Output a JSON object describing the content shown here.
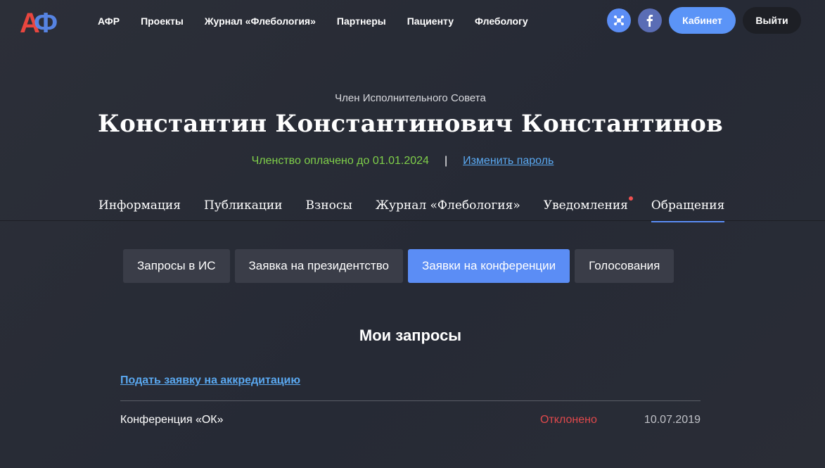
{
  "header": {
    "logo": {
      "text": "АФ",
      "colors": [
        "#e8463f",
        "#5b8df5"
      ]
    },
    "nav": [
      "АФР",
      "Проекты",
      "Журнал «Флебология»",
      "Партнеры",
      "Пациенту",
      "Флебологу"
    ],
    "social": [
      {
        "icon": "network-icon",
        "color": "#5b8df5"
      },
      {
        "icon": "facebook-icon",
        "color": "#5a6db5"
      }
    ],
    "cabinet_label": "Кабинет",
    "logout_label": "Выйти"
  },
  "profile": {
    "role": "Член Исполнительного Совета",
    "name": "Константин Константинович Константинов",
    "membership": "Членство оплачено до 01.01.2024",
    "separator": "|",
    "change_password": "Изменить пароль"
  },
  "tabs": [
    {
      "label": "Информация",
      "active": false,
      "notification": false
    },
    {
      "label": "Публикации",
      "active": false,
      "notification": false
    },
    {
      "label": "Взносы",
      "active": false,
      "notification": false
    },
    {
      "label": "Журнал «Флебология»",
      "active": false,
      "notification": false
    },
    {
      "label": "Уведомления",
      "active": false,
      "notification": true
    },
    {
      "label": "Обращения",
      "active": true,
      "notification": false
    }
  ],
  "subtabs": [
    {
      "label": "Запросы в ИС",
      "active": false
    },
    {
      "label": "Заявка на президентство",
      "active": false
    },
    {
      "label": "Заявки на конференции",
      "active": true
    },
    {
      "label": "Голосования",
      "active": false
    }
  ],
  "requests": {
    "title": "Мои запросы",
    "apply_link": "Подать заявку на аккредитацию",
    "rows": [
      {
        "name": "Конференция «ОК»",
        "status": "Отклонено",
        "date": "10.07.2019"
      }
    ]
  },
  "colors": {
    "accent": "#5b8df5",
    "success": "#7fcf4a",
    "error": "#e0494c",
    "link": "#5aa8f0"
  }
}
